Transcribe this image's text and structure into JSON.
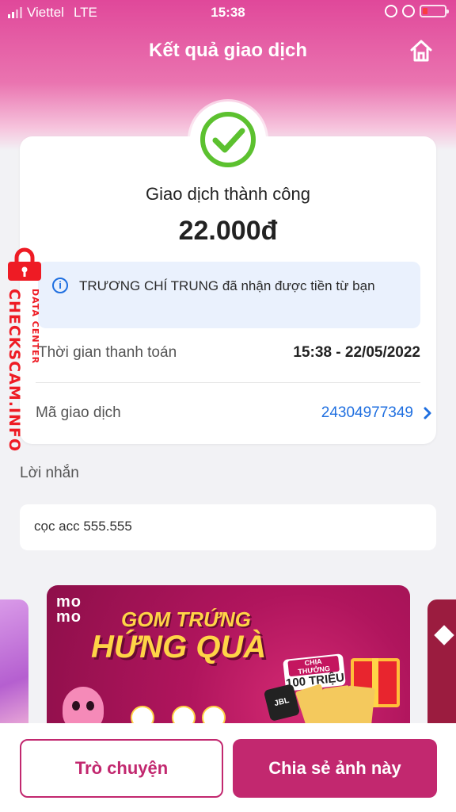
{
  "status_bar": {
    "carrier": "Viettel",
    "network": "LTE",
    "time": "15:38"
  },
  "header": {
    "title": "Kết quả giao dịch",
    "home_icon": "home-icon"
  },
  "result": {
    "status_icon": "check-circle-icon",
    "status_text": "Giao dịch thành công",
    "amount": "22.000đ",
    "info_message": "TRƯƠNG CHÍ TRUNG đã nhận được tiền từ bạn"
  },
  "details": {
    "payment_time_label": "Thời gian thanh toán",
    "payment_time_value": "15:38 - 22/05/2022",
    "transaction_id_label": "Mã giao dịch",
    "transaction_id_value": "24304977349"
  },
  "message": {
    "heading": "Lời nhắn",
    "text": "cọc acc 555.555"
  },
  "banner": {
    "logo_line1": "mo",
    "logo_line2": "mo",
    "title_line1": "GOM TRỨNG",
    "title_line2": "HỨNG QUÀ",
    "prize_label": "CHIA THƯỞNG",
    "prize_value": "100 TRIỆU",
    "speaker_brand": "JBL"
  },
  "actions": {
    "chat_label": "Trò chuyện",
    "share_label": "Chia sẻ ảnh này"
  },
  "watermark": {
    "site": "CHECKSCAM.INFO",
    "sub": "DATA CENTER"
  },
  "colors": {
    "brand": "#c2286f",
    "success": "#5cc12f",
    "link": "#1f6fe0",
    "watermark": "#ee1b24"
  }
}
